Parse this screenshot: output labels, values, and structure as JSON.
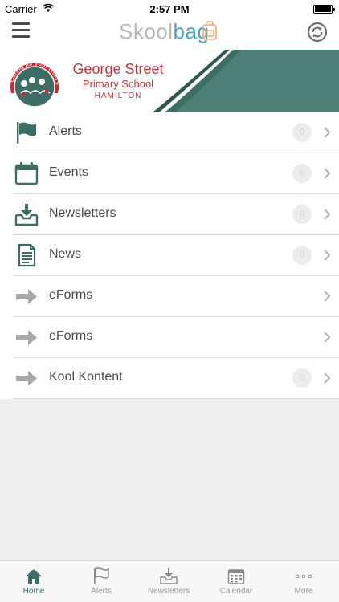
{
  "status_bar": {
    "carrier": "Carrier",
    "time": "2:57 PM",
    "battery_level": 1.0
  },
  "nav_bar": {
    "brand_part1": "Skool",
    "brand_part2": "bag",
    "left_icon": "hamburger-menu-icon",
    "right_icon": "sync-icon"
  },
  "school": {
    "name_line1": "George Street",
    "name_line2": "Primary School",
    "name_line3": "HAMILTON",
    "logo_motto": "Caring for your child's future",
    "brand_color": "#3d6e66",
    "text_color": "#c8313b"
  },
  "menu": {
    "items": [
      {
        "label": "Alerts",
        "icon": "flag-icon",
        "badge": "0",
        "show_badge": true
      },
      {
        "label": "Events",
        "icon": "calendar-icon",
        "badge": "0",
        "show_badge": true
      },
      {
        "label": "Newsletters",
        "icon": "inbox-download-icon",
        "badge": "0",
        "show_badge": true
      },
      {
        "label": "News",
        "icon": "document-icon",
        "badge": "0",
        "show_badge": true
      },
      {
        "label": "eForms",
        "icon": "arrow-right-icon",
        "badge": "",
        "show_badge": false
      },
      {
        "label": "eForms",
        "icon": "arrow-right-icon",
        "badge": "",
        "show_badge": false
      },
      {
        "label": "Kool Kontent",
        "icon": "arrow-right-icon",
        "badge": "0",
        "show_badge": true
      }
    ]
  },
  "tab_bar": {
    "active_index": 0,
    "tabs": [
      {
        "label": "Home",
        "icon": "home-icon"
      },
      {
        "label": "Alerts",
        "icon": "flag-icon"
      },
      {
        "label": "Newsletters",
        "icon": "inbox-download-icon"
      },
      {
        "label": "Calendar",
        "icon": "calendar-icon"
      },
      {
        "label": "More",
        "icon": "more-dots-icon"
      }
    ]
  }
}
